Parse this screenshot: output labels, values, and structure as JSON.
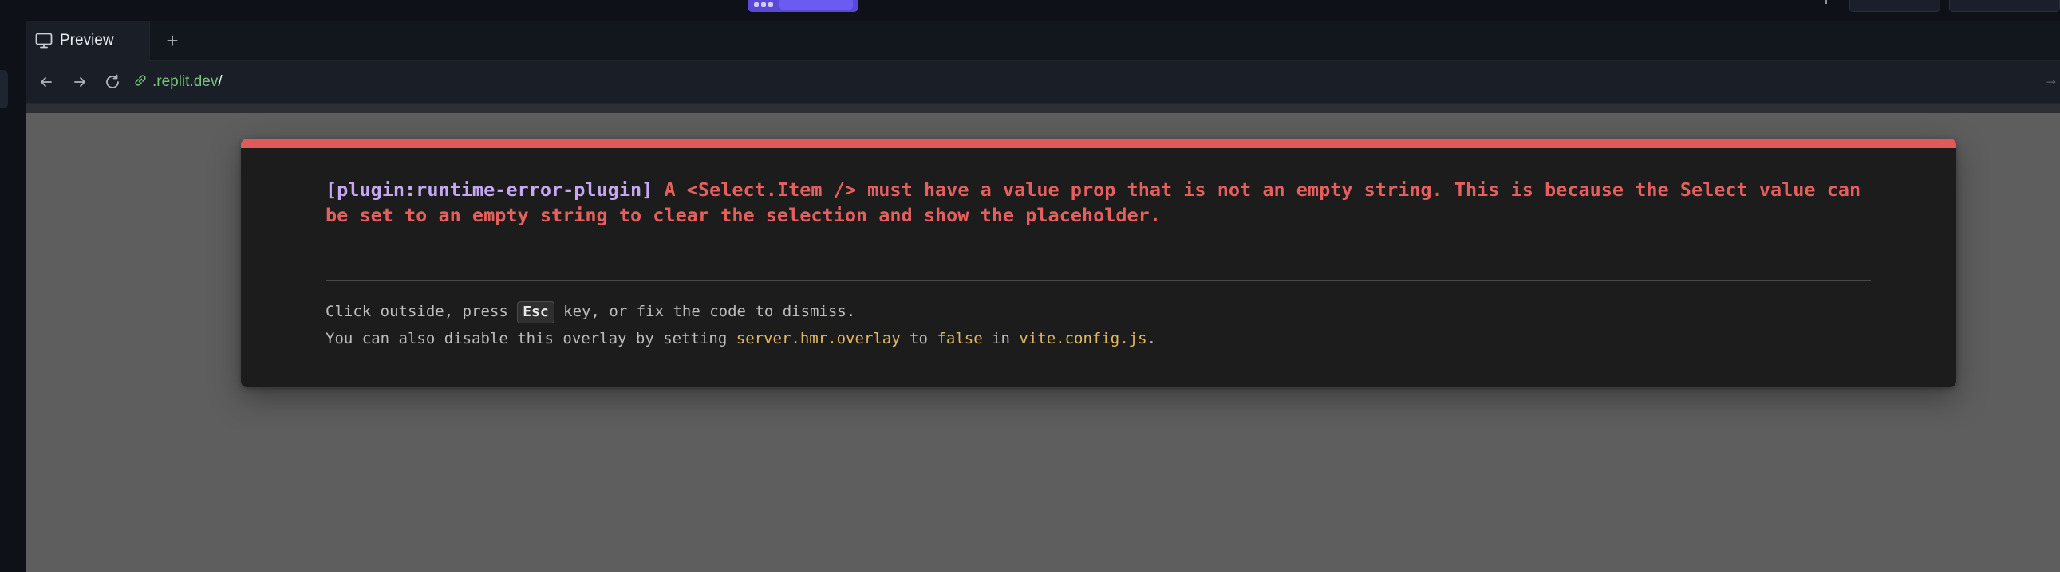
{
  "topbar": {
    "accent_color": "#5a48d6"
  },
  "tabs": [
    {
      "label": "Preview",
      "icon": "monitor-icon",
      "active": true
    }
  ],
  "tabbar": {
    "add_tab_label": "+"
  },
  "navigation": {
    "back_icon": "arrow-left-icon",
    "forward_icon": "arrow-right-icon",
    "reload_icon": "reload-icon",
    "link_icon": "link-icon",
    "url_domain": ".replit.dev",
    "url_path": "/",
    "expand_icon": "arrow-right-bar-icon"
  },
  "error_overlay": {
    "plugin": "[plugin:runtime-error-plugin]",
    "message": "A <Select.Item /> must have a value prop that is not an empty string. This is because the Select value can be set to an empty string to clear the selection and show the placeholder.",
    "tip_line1_before": "Click outside, press ",
    "tip_key": "Esc",
    "tip_line1_after": " key, or fix the code to dismiss.",
    "tip_line2_before": "You can also disable this overlay by setting ",
    "tip_config_key": "server.hmr.overlay",
    "tip_to": " to ",
    "tip_value": "false",
    "tip_in": " in ",
    "tip_file": "vite.config.js",
    "tip_end": ".",
    "colors": {
      "accent": "#e05a5a",
      "plugin": "#c5a8f2",
      "code": "#e3b75e"
    }
  }
}
